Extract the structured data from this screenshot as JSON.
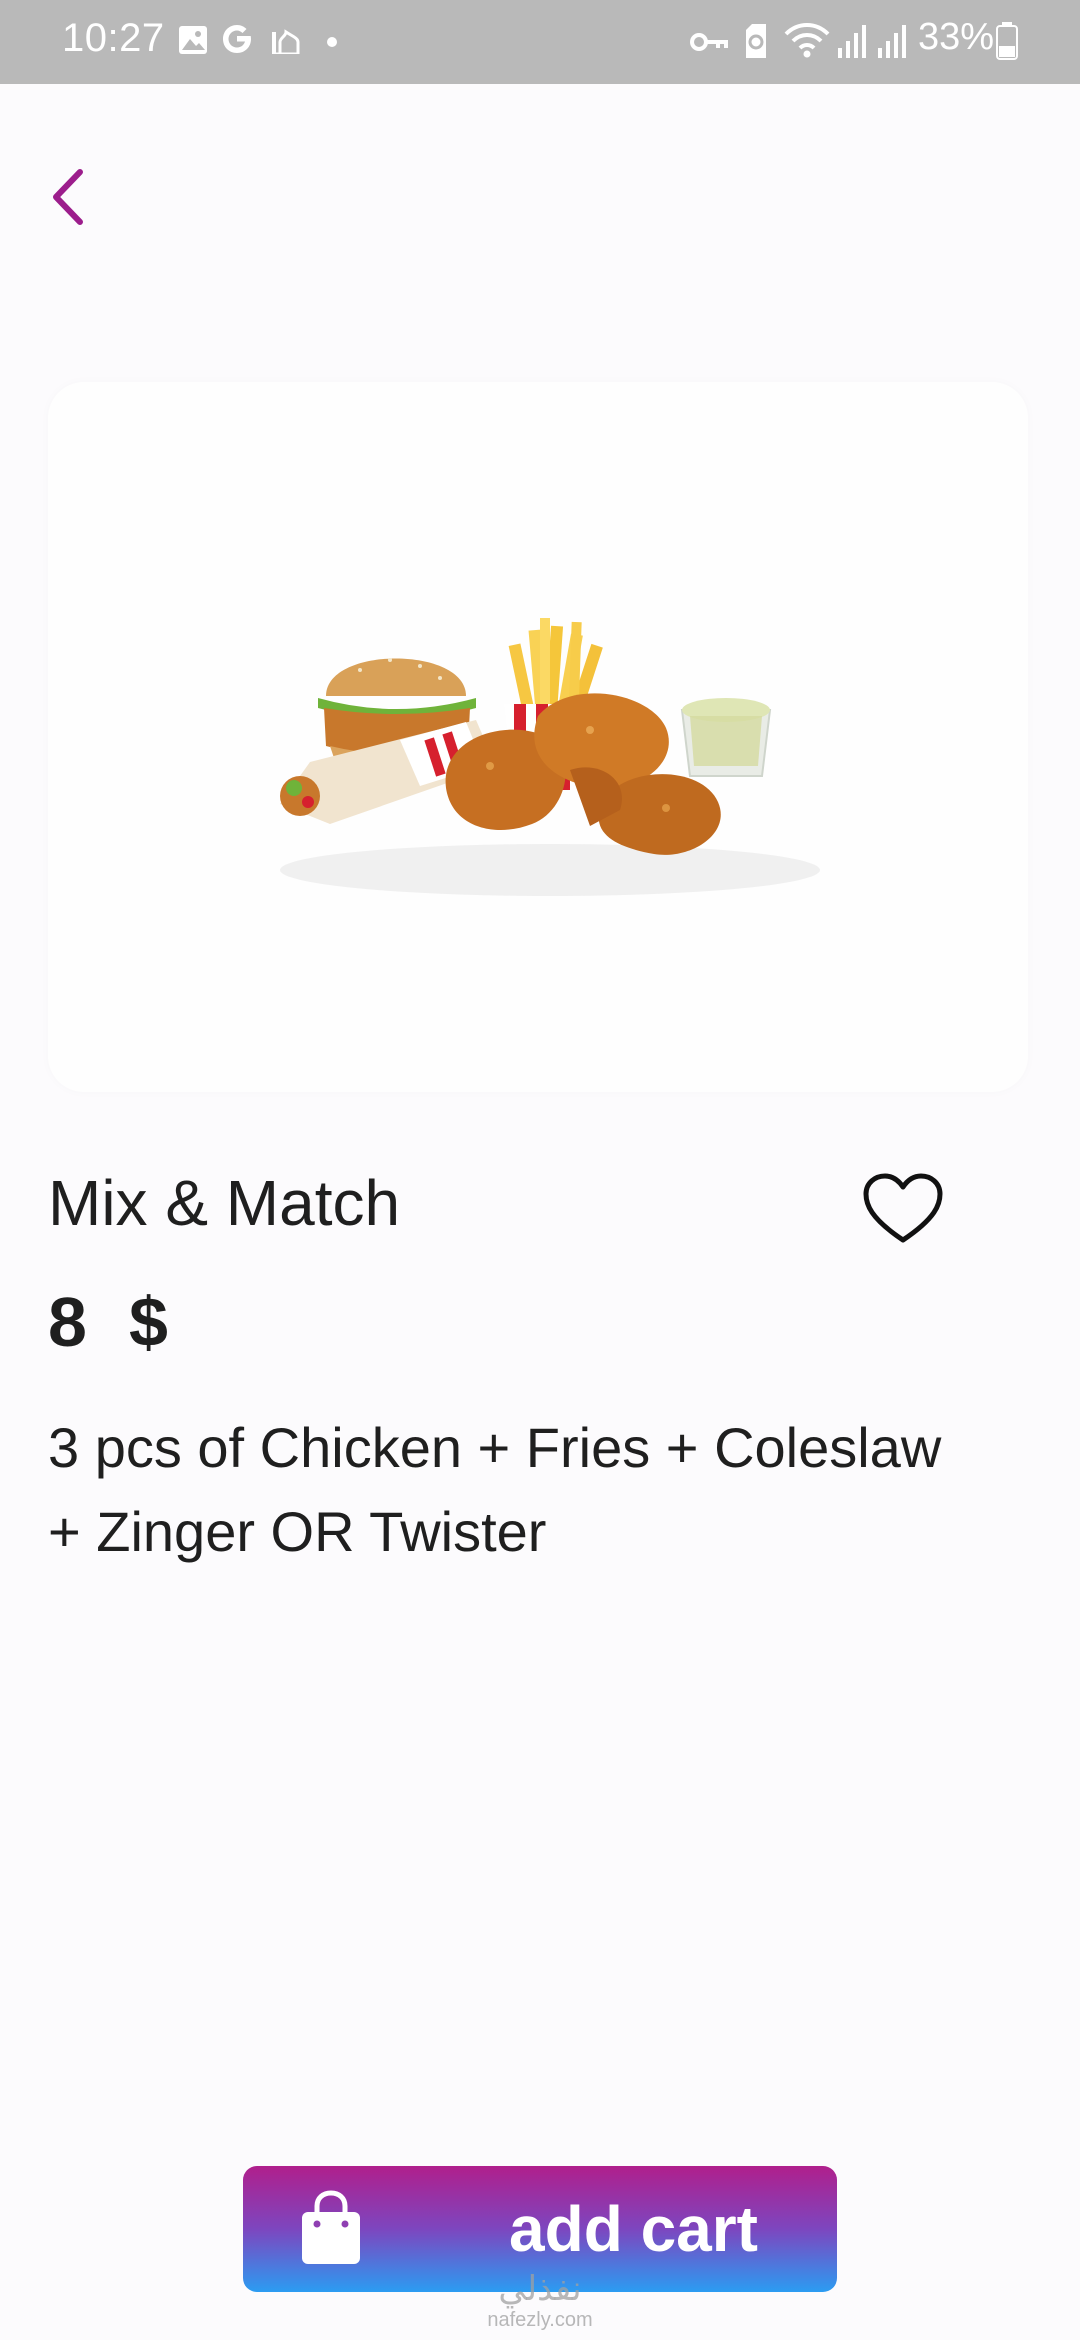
{
  "status_bar": {
    "time": "10:27",
    "battery": "33%",
    "icons": [
      "gallery-icon",
      "google-icon",
      "mosque-icon",
      "dot-icon",
      "key-icon",
      "nfc-icon",
      "wifi-icon",
      "signal-icon",
      "signal-icon",
      "battery-icon"
    ]
  },
  "navigation": {
    "back_icon": "chevron-left-icon",
    "accent_color": "#9c1d8c"
  },
  "product": {
    "image_alt": "Fried chicken combo meal",
    "title": "Mix & Match",
    "price_value": "8",
    "price_currency": "$",
    "description": "3 pcs of Chicken + Fries + Coleslaw + Zinger OR Twister",
    "favorite_icon": "heart-outline-icon"
  },
  "cart_button": {
    "label": "add cart",
    "icon": "shopping-bag-icon",
    "gradient": [
      "#b01f8c",
      "#7d46bf",
      "#2b9cf2"
    ]
  },
  "watermark": {
    "main": "نفذلي",
    "sub": "nafezly.com"
  }
}
